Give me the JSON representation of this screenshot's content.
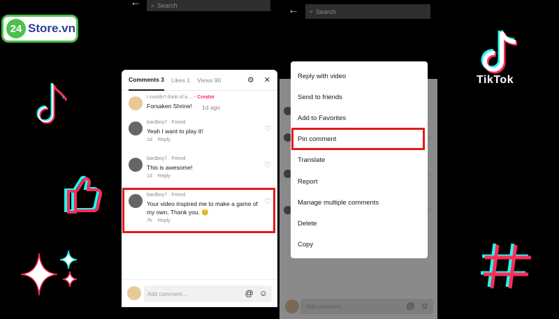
{
  "brand": {
    "number": "24",
    "name": "Store.vn"
  },
  "phone1": {
    "search_placeholder": "Search",
    "tabs": [
      {
        "label": "Comments 3",
        "active": true
      },
      {
        "label": "Likes 1",
        "active": false
      },
      {
        "label": "Views 90",
        "active": false
      }
    ],
    "comments": [
      {
        "user": "I couldn't think of a ...",
        "tag": "· Creator",
        "text": "Forsaken Shrine!",
        "time": "1d ago",
        "reply": ""
      },
      {
        "user": "bardboy7",
        "tag": "· Friend",
        "text": "Yeah I want to play it!",
        "time": "1d",
        "reply": "Reply"
      },
      {
        "user": "bardboy7",
        "tag": "· Friend",
        "text": "This is awesome!",
        "time": "1d",
        "reply": "Reply"
      },
      {
        "user": "bardboy7",
        "tag": "· Friend",
        "text": "Your video inspired me to make a game of my own. Thank you. 😊",
        "time": "7h",
        "reply": "Reply"
      }
    ],
    "input_placeholder": "Add comment..."
  },
  "phone2": {
    "search_placeholder": "Search",
    "menu": [
      "Reply with video",
      "Send to friends",
      "Add to Favorites",
      "Pin comment",
      "Translate",
      "Report",
      "Manage multiple comments",
      "Delete",
      "Copy"
    ],
    "input_placeholder": "Add comment..."
  },
  "tiktok": {
    "wordmark": "TikTok"
  },
  "colors": {
    "accent_red": "#e11a1a",
    "creator_red": "#fe2c55",
    "brand_green": "#4cc24c"
  },
  "icons": [
    "back-arrow-icon",
    "search-icon",
    "filter-icon",
    "close-icon",
    "heart-icon",
    "at-icon",
    "emoji-icon",
    "music-note-icon",
    "thumbs-up-icon",
    "sparkle-icon",
    "hashtag-icon",
    "tiktok-logo-icon"
  ]
}
